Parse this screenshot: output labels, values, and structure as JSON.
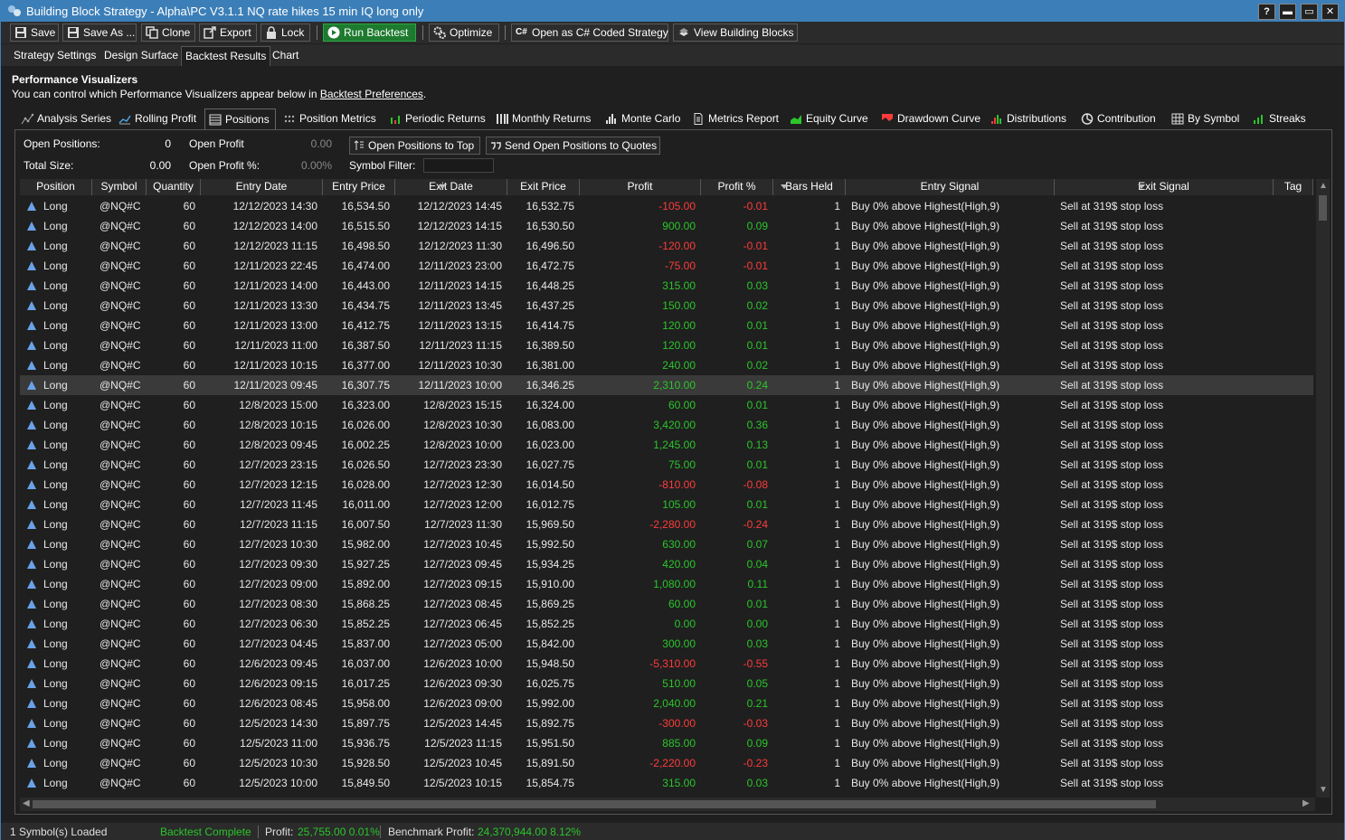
{
  "window": {
    "title": "Building Block Strategy - Alpha\\PC V3.1.1 NQ rate hikes 15 min IQ long only",
    "help": "?",
    "minimize": "▬",
    "maximize": "▭",
    "close": "✕"
  },
  "toolbar": {
    "save": "Save",
    "save_as": "Save As ...",
    "clone": "Clone",
    "export": "Export",
    "lock": "Lock",
    "run": "Run Backtest",
    "optimize": "Optimize",
    "open_csharp": "Open as C# Coded Strategy",
    "view_blocks": "View Building Blocks"
  },
  "main_tabs": [
    "Strategy Settings",
    "Design Surface",
    "Backtest Results",
    "Chart"
  ],
  "performance": {
    "heading": "Performance Visualizers",
    "desc_prefix": "You can control which Performance Visualizers appear below in ",
    "desc_link": "Backtest Preferences",
    "desc_suffix": "."
  },
  "vis_tabs": [
    "Analysis Series",
    "Rolling Profit",
    "Positions",
    "Position Metrics",
    "Periodic Returns",
    "Monthly Returns",
    "Monte Carlo",
    "Metrics Report",
    "Equity Curve",
    "Drawdown Curve",
    "Distributions",
    "Contribution",
    "By Symbol",
    "Streaks"
  ],
  "summary": {
    "open_positions_label": "Open Positions:",
    "open_positions": "0",
    "total_size_label": "Total Size:",
    "total_size": "0.00",
    "open_profit_label": "Open Profit",
    "open_profit": "0.00",
    "open_profit_pct_label": "Open Profit %:",
    "open_profit_pct": "0.00%",
    "open_to_top": "Open Positions to Top",
    "send_quotes": "Send Open Positions to Quotes",
    "symbol_filter_label": "Symbol Filter:",
    "symbol_filter_value": ""
  },
  "columns": [
    "Position",
    "Symbol",
    "Quantity",
    "Entry Date",
    "Entry Price",
    "Exit Date",
    "Exit Price",
    "Profit",
    "Profit %",
    "Bars Held",
    "Entry Signal",
    "Exit Signal",
    "Tag"
  ],
  "rows": [
    [
      "Long",
      "@NQ#C",
      "60",
      "12/12/2023 14:30",
      "16,534.50",
      "12/12/2023 14:45",
      "16,532.75",
      "-105.00",
      "-0.01",
      "1",
      "Buy 0%  above Highest(High,9)",
      "Sell at 319$ stop loss",
      ""
    ],
    [
      "Long",
      "@NQ#C",
      "60",
      "12/12/2023 14:00",
      "16,515.50",
      "12/12/2023 14:15",
      "16,530.50",
      "900.00",
      "0.09",
      "1",
      "Buy 0%  above Highest(High,9)",
      "Sell at 319$ stop loss",
      ""
    ],
    [
      "Long",
      "@NQ#C",
      "60",
      "12/12/2023 11:15",
      "16,498.50",
      "12/12/2023 11:30",
      "16,496.50",
      "-120.00",
      "-0.01",
      "1",
      "Buy 0%  above Highest(High,9)",
      "Sell at 319$ stop loss",
      ""
    ],
    [
      "Long",
      "@NQ#C",
      "60",
      "12/11/2023 22:45",
      "16,474.00",
      "12/11/2023 23:00",
      "16,472.75",
      "-75.00",
      "-0.01",
      "1",
      "Buy 0%  above Highest(High,9)",
      "Sell at 319$ stop loss",
      ""
    ],
    [
      "Long",
      "@NQ#C",
      "60",
      "12/11/2023 14:00",
      "16,443.00",
      "12/11/2023 14:15",
      "16,448.25",
      "315.00",
      "0.03",
      "1",
      "Buy 0%  above Highest(High,9)",
      "Sell at 319$ stop loss",
      ""
    ],
    [
      "Long",
      "@NQ#C",
      "60",
      "12/11/2023 13:30",
      "16,434.75",
      "12/11/2023 13:45",
      "16,437.25",
      "150.00",
      "0.02",
      "1",
      "Buy 0%  above Highest(High,9)",
      "Sell at 319$ stop loss",
      ""
    ],
    [
      "Long",
      "@NQ#C",
      "60",
      "12/11/2023 13:00",
      "16,412.75",
      "12/11/2023 13:15",
      "16,414.75",
      "120.00",
      "0.01",
      "1",
      "Buy 0%  above Highest(High,9)",
      "Sell at 319$ stop loss",
      ""
    ],
    [
      "Long",
      "@NQ#C",
      "60",
      "12/11/2023 11:00",
      "16,387.50",
      "12/11/2023 11:15",
      "16,389.50",
      "120.00",
      "0.01",
      "1",
      "Buy 0%  above Highest(High,9)",
      "Sell at 319$ stop loss",
      ""
    ],
    [
      "Long",
      "@NQ#C",
      "60",
      "12/11/2023 10:15",
      "16,377.00",
      "12/11/2023 10:30",
      "16,381.00",
      "240.00",
      "0.02",
      "1",
      "Buy 0%  above Highest(High,9)",
      "Sell at 319$ stop loss",
      ""
    ],
    [
      "Long",
      "@NQ#C",
      "60",
      "12/11/2023 09:45",
      "16,307.75",
      "12/11/2023 10:00",
      "16,346.25",
      "2,310.00",
      "0.24",
      "1",
      "Buy 0%  above Highest(High,9)",
      "Sell at 319$ stop loss",
      ""
    ],
    [
      "Long",
      "@NQ#C",
      "60",
      "12/8/2023 15:00",
      "16,323.00",
      "12/8/2023 15:15",
      "16,324.00",
      "60.00",
      "0.01",
      "1",
      "Buy 0%  above Highest(High,9)",
      "Sell at 319$ stop loss",
      ""
    ],
    [
      "Long",
      "@NQ#C",
      "60",
      "12/8/2023 10:15",
      "16,026.00",
      "12/8/2023 10:30",
      "16,083.00",
      "3,420.00",
      "0.36",
      "1",
      "Buy 0%  above Highest(High,9)",
      "Sell at 319$ stop loss",
      ""
    ],
    [
      "Long",
      "@NQ#C",
      "60",
      "12/8/2023 09:45",
      "16,002.25",
      "12/8/2023 10:00",
      "16,023.00",
      "1,245.00",
      "0.13",
      "1",
      "Buy 0%  above Highest(High,9)",
      "Sell at 319$ stop loss",
      ""
    ],
    [
      "Long",
      "@NQ#C",
      "60",
      "12/7/2023 23:15",
      "16,026.50",
      "12/7/2023 23:30",
      "16,027.75",
      "75.00",
      "0.01",
      "1",
      "Buy 0%  above Highest(High,9)",
      "Sell at 319$ stop loss",
      ""
    ],
    [
      "Long",
      "@NQ#C",
      "60",
      "12/7/2023 12:15",
      "16,028.00",
      "12/7/2023 12:30",
      "16,014.50",
      "-810.00",
      "-0.08",
      "1",
      "Buy 0%  above Highest(High,9)",
      "Sell at 319$ stop loss",
      ""
    ],
    [
      "Long",
      "@NQ#C",
      "60",
      "12/7/2023 11:45",
      "16,011.00",
      "12/7/2023 12:00",
      "16,012.75",
      "105.00",
      "0.01",
      "1",
      "Buy 0%  above Highest(High,9)",
      "Sell at 319$ stop loss",
      ""
    ],
    [
      "Long",
      "@NQ#C",
      "60",
      "12/7/2023 11:15",
      "16,007.50",
      "12/7/2023 11:30",
      "15,969.50",
      "-2,280.00",
      "-0.24",
      "1",
      "Buy 0%  above Highest(High,9)",
      "Sell at 319$ stop loss",
      ""
    ],
    [
      "Long",
      "@NQ#C",
      "60",
      "12/7/2023 10:30",
      "15,982.00",
      "12/7/2023 10:45",
      "15,992.50",
      "630.00",
      "0.07",
      "1",
      "Buy 0%  above Highest(High,9)",
      "Sell at 319$ stop loss",
      ""
    ],
    [
      "Long",
      "@NQ#C",
      "60",
      "12/7/2023 09:30",
      "15,927.25",
      "12/7/2023 09:45",
      "15,934.25",
      "420.00",
      "0.04",
      "1",
      "Buy 0%  above Highest(High,9)",
      "Sell at 319$ stop loss",
      ""
    ],
    [
      "Long",
      "@NQ#C",
      "60",
      "12/7/2023 09:00",
      "15,892.00",
      "12/7/2023 09:15",
      "15,910.00",
      "1,080.00",
      "0.11",
      "1",
      "Buy 0%  above Highest(High,9)",
      "Sell at 319$ stop loss",
      ""
    ],
    [
      "Long",
      "@NQ#C",
      "60",
      "12/7/2023 08:30",
      "15,868.25",
      "12/7/2023 08:45",
      "15,869.25",
      "60.00",
      "0.01",
      "1",
      "Buy 0%  above Highest(High,9)",
      "Sell at 319$ stop loss",
      ""
    ],
    [
      "Long",
      "@NQ#C",
      "60",
      "12/7/2023 06:30",
      "15,852.25",
      "12/7/2023 06:45",
      "15,852.25",
      "0.00",
      "0.00",
      "1",
      "Buy 0%  above Highest(High,9)",
      "Sell at 319$ stop loss",
      ""
    ],
    [
      "Long",
      "@NQ#C",
      "60",
      "12/7/2023 04:45",
      "15,837.00",
      "12/7/2023 05:00",
      "15,842.00",
      "300.00",
      "0.03",
      "1",
      "Buy 0%  above Highest(High,9)",
      "Sell at 319$ stop loss",
      ""
    ],
    [
      "Long",
      "@NQ#C",
      "60",
      "12/6/2023 09:45",
      "16,037.00",
      "12/6/2023 10:00",
      "15,948.50",
      "-5,310.00",
      "-0.55",
      "1",
      "Buy 0%  above Highest(High,9)",
      "Sell at 319$ stop loss",
      ""
    ],
    [
      "Long",
      "@NQ#C",
      "60",
      "12/6/2023 09:15",
      "16,017.25",
      "12/6/2023 09:30",
      "16,025.75",
      "510.00",
      "0.05",
      "1",
      "Buy 0%  above Highest(High,9)",
      "Sell at 319$ stop loss",
      ""
    ],
    [
      "Long",
      "@NQ#C",
      "60",
      "12/6/2023 08:45",
      "15,958.00",
      "12/6/2023 09:00",
      "15,992.00",
      "2,040.00",
      "0.21",
      "1",
      "Buy 0%  above Highest(High,9)",
      "Sell at 319$ stop loss",
      ""
    ],
    [
      "Long",
      "@NQ#C",
      "60",
      "12/5/2023 14:30",
      "15,897.75",
      "12/5/2023 14:45",
      "15,892.75",
      "-300.00",
      "-0.03",
      "1",
      "Buy 0%  above Highest(High,9)",
      "Sell at 319$ stop loss",
      ""
    ],
    [
      "Long",
      "@NQ#C",
      "60",
      "12/5/2023 11:00",
      "15,936.75",
      "12/5/2023 11:15",
      "15,951.50",
      "885.00",
      "0.09",
      "1",
      "Buy 0%  above Highest(High,9)",
      "Sell at 319$ stop loss",
      ""
    ],
    [
      "Long",
      "@NQ#C",
      "60",
      "12/5/2023 10:30",
      "15,928.50",
      "12/5/2023 10:45",
      "15,891.50",
      "-2,220.00",
      "-0.23",
      "1",
      "Buy 0%  above Highest(High,9)",
      "Sell at 319$ stop loss",
      ""
    ],
    [
      "Long",
      "@NQ#C",
      "60",
      "12/5/2023 10:00",
      "15,849.50",
      "12/5/2023 10:15",
      "15,854.75",
      "315.00",
      "0.03",
      "1",
      "Buy 0%  above Highest(High,9)",
      "Sell at 319$ stop loss",
      ""
    ]
  ],
  "selected_row": 9,
  "status": {
    "symbols": "1 Symbol(s) Loaded",
    "state": "Backtest Complete",
    "profit_label": "Profit:",
    "profit_value": "25,755.00 0.01%",
    "bench_label": "Benchmark Profit:",
    "bench_value": "24,370,944.00 8.12%"
  },
  "colors": {
    "title_bar": "#3c7fb8",
    "positive": "#2bc52b",
    "negative": "#ff3b3b",
    "run_button": "#1d7a2f"
  }
}
